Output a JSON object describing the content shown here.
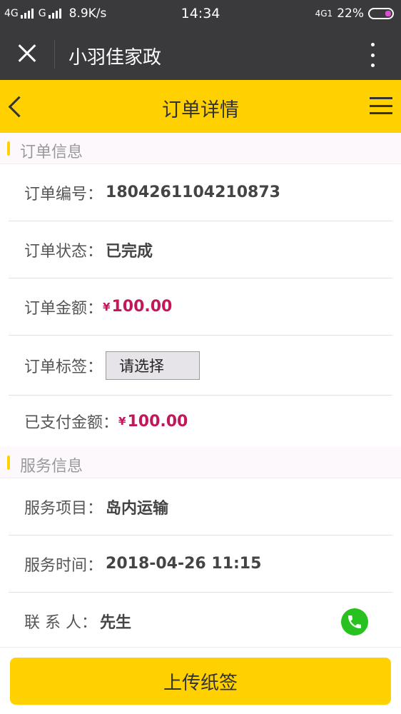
{
  "status_bar": {
    "net1": "4G",
    "net2": "G",
    "speed": "8.9K/s",
    "time": "14:34",
    "net_right": "4G1",
    "battery": "22%"
  },
  "title_bar": {
    "title": "小羽佳家政",
    "close_icon": "close-icon",
    "more_icon": "more-vertical-icon"
  },
  "nav_bar": {
    "title": "订单详情",
    "back_icon": "chevron-left-icon",
    "menu_icon": "hamburger-menu-icon",
    "background": "#ffd100"
  },
  "order_section": {
    "header": "订单信息",
    "rows": [
      {
        "label": "订单编号：",
        "value": "1804261104210873"
      },
      {
        "label": "订单状态：",
        "value": "已完成"
      },
      {
        "label": "订单金额：",
        "currency": "¥",
        "value": "100.00"
      },
      {
        "label": "订单标签：",
        "select_value": "请选择"
      },
      {
        "label": "已支付金额：",
        "currency": "¥",
        "value": "100.00"
      }
    ]
  },
  "service_section": {
    "header": "服务信息",
    "rows": [
      {
        "label": "服务项目：",
        "value": "岛内运输"
      },
      {
        "label": "服务时间：",
        "value": "2018-04-26 11:15"
      },
      {
        "label": "联 系 人：",
        "value": "先生"
      }
    ]
  },
  "bottom": {
    "button_label": "上传纸签"
  },
  "colors": {
    "accent": "#ffd100",
    "money": "#c2185b",
    "phone": "#27c21f",
    "dark_bar": "#3a3a3c"
  }
}
